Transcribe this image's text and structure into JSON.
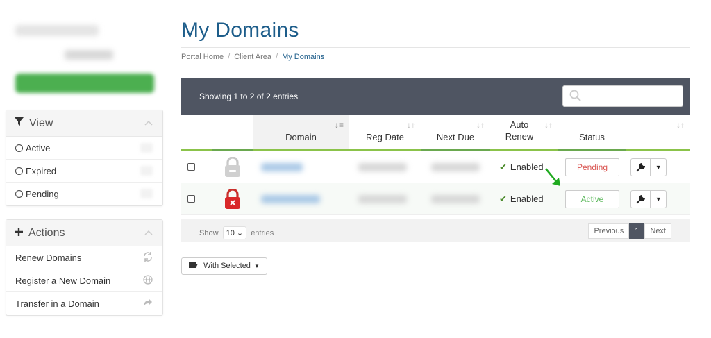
{
  "sidebar": {
    "view_panel": {
      "title": "View",
      "items": [
        {
          "label": "Active"
        },
        {
          "label": "Expired"
        },
        {
          "label": "Pending"
        }
      ]
    },
    "actions_panel": {
      "title": "Actions",
      "items": [
        {
          "label": "Renew Domains",
          "icon": "refresh-icon"
        },
        {
          "label": "Register a New Domain",
          "icon": "globe-icon"
        },
        {
          "label": "Transfer in a Domain",
          "icon": "share-arrow-icon"
        }
      ]
    }
  },
  "page": {
    "title": "My Domains",
    "breadcrumb": [
      "Portal Home",
      "Client Area",
      "My Domains"
    ]
  },
  "table": {
    "info": "Showing 1 to 2 of 2 entries",
    "columns": [
      "Domain",
      "Reg Date",
      "Next Due",
      "Auto Renew",
      "Status"
    ],
    "rows": [
      {
        "auto_renew": "Enabled",
        "status": "Pending",
        "status_color": "#d9534f",
        "lock": "gray"
      },
      {
        "auto_renew": "Enabled",
        "status": "Active",
        "status_color": "#5cb85c",
        "lock": "red"
      }
    ],
    "length_label_before": "Show",
    "length_value": "10",
    "length_label_after": "entries",
    "pager": {
      "previous": "Previous",
      "current": "1",
      "next": "Next"
    }
  },
  "bulk": {
    "label": "With Selected"
  },
  "colors": {
    "brand": "#1d5d8a",
    "header_bar": "#4f5562",
    "accent_green": "#8bc34a",
    "pending": "#d9534f",
    "active": "#5cb85c"
  }
}
